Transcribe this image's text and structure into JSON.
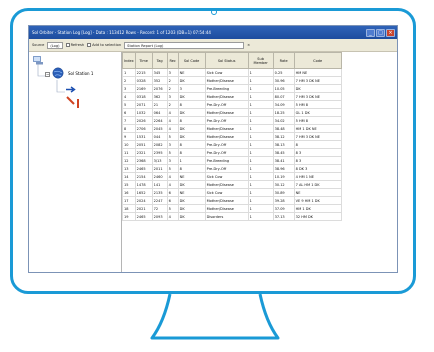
{
  "window": {
    "title": "Sol Orbiter - Station Log [Log] - Data : 113412 Rows - Record: 1 of 1203 (DB=1) 07:54:44",
    "buttons": [
      "_",
      "□",
      "×"
    ]
  },
  "toolbar": {
    "source_label": "Source",
    "source_value": "(Log)",
    "refresh_label": "Refresh",
    "add_label": "Add to selection",
    "station_value": "Station Report (Log)",
    "close_glyph": "×"
  },
  "tree": {
    "root_label": "Sol Station 1"
  },
  "table": {
    "columns": [
      "Index",
      "Time",
      "Tag",
      "Rec",
      "Sol Code",
      "Sol Status",
      "Sub Member",
      "Rate",
      "Code"
    ],
    "rows": [
      [
        "1",
        "2215",
        "345",
        "3",
        "NE",
        "Sick Cow",
        "1",
        "0.25",
        "HM NE"
      ],
      [
        "2",
        "0328",
        "352",
        "2",
        "DK",
        "Mother/Disease",
        "1",
        "30.96",
        "7 HM 3 DK NE"
      ],
      [
        "3",
        "2169",
        "2076",
        "2",
        "3",
        "Pre-Breeding",
        "1",
        "10.05",
        "DK"
      ],
      [
        "4",
        "0318",
        "362",
        "3",
        "DK",
        "Mother/Disease",
        "1",
        "80.07",
        "7 HM 3 DK NE"
      ],
      [
        "5",
        "2071",
        "21",
        "2",
        "8",
        "Pre-Dry-Off",
        "1",
        "34.09",
        "5 HM 8"
      ],
      [
        "6",
        "1032",
        "064",
        "4",
        "DK",
        "Mother/Disease",
        "1",
        "18.25",
        "GL 1 DK"
      ],
      [
        "7",
        "2026",
        "2264",
        "4",
        "8",
        "Pre-Dry-Off",
        "1",
        "34.02",
        "5 HM 8"
      ],
      [
        "8",
        "2706",
        "2045",
        "4",
        "DK",
        "Mother/Disease",
        "1",
        "38.48",
        "HM 1 DK NE"
      ],
      [
        "9",
        "1531",
        "044",
        "5",
        "DK",
        "Mother/Disease",
        "1",
        "38.12",
        "7 HM 3 DK NE"
      ],
      [
        "10",
        "2051",
        "2082",
        "3",
        "8",
        "Pre-Dry-Off",
        "1",
        "38.13",
        "8"
      ],
      [
        "11",
        "2321",
        "2395",
        "5",
        "8",
        "Pre-Dry-Off",
        "1",
        "38.45",
        "8 3"
      ],
      [
        "12",
        "2368",
        "3/13",
        "3",
        "1",
        "Pre-Breeding",
        "1",
        "38.41",
        "8 3"
      ],
      [
        "13",
        "2465",
        "2011",
        "5",
        "8",
        "Pre-Dry-Off",
        "1",
        "38.96",
        "8 DK 3"
      ],
      [
        "14",
        "2154",
        "2460",
        "4",
        "NE",
        "Sick Cow",
        "1",
        "10.19",
        "4 HM 1 NE"
      ],
      [
        "15",
        "1478",
        "141",
        "4",
        "DK",
        "Mother/Disease",
        "1",
        "30.12",
        "7 AL HM 1 DK"
      ],
      [
        "16",
        "1652",
        "2135",
        "6",
        "NE",
        "Sick Cow",
        "1",
        "30.89",
        "NE"
      ],
      [
        "17",
        "2024",
        "2247",
        "6",
        "DK",
        "Mother/Disease",
        "1",
        "39.28",
        "VE 9 HM 1 DK"
      ],
      [
        "18",
        "2021",
        "72",
        "5",
        "DK",
        "Mother/Disease",
        "1",
        "37.09",
        "HM 1 DK"
      ],
      [
        "19",
        "2465",
        "2093",
        "4",
        "DK",
        "Disorders",
        "1",
        "37.13",
        "32 HM DK"
      ]
    ]
  }
}
